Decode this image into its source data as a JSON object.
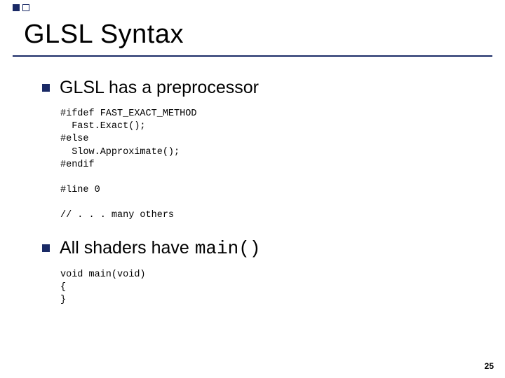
{
  "title": "GLSL Syntax",
  "bullets": {
    "b1": "GLSL has a preprocessor",
    "b2_prefix": "All shaders have ",
    "b2_mono": "main()"
  },
  "code": {
    "block1": "#ifdef FAST_EXACT_METHOD\n  Fast.Exact();\n#else\n  Slow.Approximate();\n#endif",
    "block2": "#line 0",
    "block3": "// . . . many others",
    "block4": "void main(void)\n{\n}"
  },
  "page_number": "25"
}
